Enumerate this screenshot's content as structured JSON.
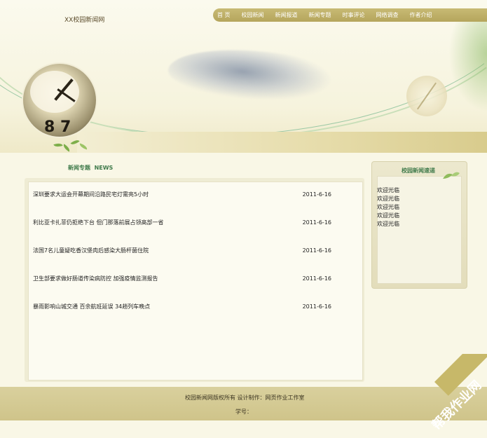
{
  "site": {
    "title": "XX校园新闻网"
  },
  "nav": {
    "items": [
      {
        "label": "首 页"
      },
      {
        "label": "校园新闻"
      },
      {
        "label": "新闻报道"
      },
      {
        "label": "新闻专题"
      },
      {
        "label": "时事评论"
      },
      {
        "label": "网络调查"
      },
      {
        "label": "作者介绍"
      }
    ]
  },
  "main": {
    "heading": "新闻专题  NEWS",
    "news": [
      {
        "title": "深圳要求大运会开幕期间沿路民宅灯需亮5小时",
        "date": "2011-6-16"
      },
      {
        "title": "利比亚卡扎菲仍拒绝下台 但门那落前展占领高部一省",
        "date": "2011-6-16"
      },
      {
        "title": "法国7名儿童疑吃香汉堡肉后感染大肠杆菌住院",
        "date": "2011-6-16"
      },
      {
        "title": "卫生部要求做好肠道传染病防控 加强疫情监测报告",
        "date": "2011-6-16"
      },
      {
        "title": "暴雨影响山城交通 百余航班延误 34趟列车晚点",
        "date": "2011-6-16"
      }
    ]
  },
  "sidebar": {
    "title": "校园新闻速递",
    "items": [
      "欢迎光临",
      "欢迎光临",
      "欢迎光临",
      "欢迎光临",
      "欢迎光临"
    ]
  },
  "footer": {
    "copyright": "校园新闻网版权所有 设计制作：网页作业工作室",
    "student_id": "学号："
  },
  "watermark": {
    "text": "帮我作业网"
  },
  "colors": {
    "nav_bg": "#b5a55c",
    "accent_green": "#3f7a4a",
    "footer_bg": "#cfc48a",
    "page_bg": "#f9f7e6"
  }
}
